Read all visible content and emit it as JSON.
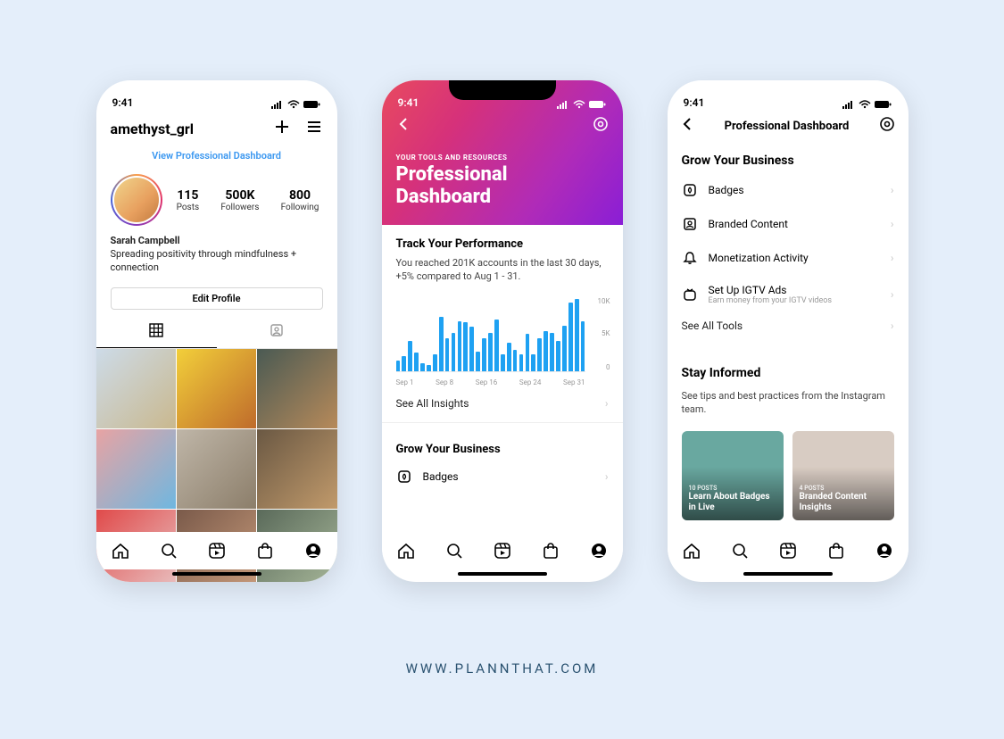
{
  "footer": "WWW.PLANNTHAT.COM",
  "status_time": "9:41",
  "phone1": {
    "username": "amethyst_grl",
    "vpd_link": "View Professional Dashboard",
    "stats": [
      {
        "num": "115",
        "lbl": "Posts"
      },
      {
        "num": "500K",
        "lbl": "Followers"
      },
      {
        "num": "800",
        "lbl": "Following"
      }
    ],
    "display_name": "Sarah Campbell",
    "bio": "Spreading positivity through mindfulness + connection",
    "edit_profile": "Edit Profile"
  },
  "phone2": {
    "eyebrow": "YOUR TOOLS AND RESOURCES",
    "title_line1": "Professional",
    "title_line2": "Dashboard",
    "track_h": "Track Your Performance",
    "track_sub": "You reached 201K accounts in the last 30 days, +5% compared to Aug 1 - 31.",
    "see_all_insights": "See All Insights",
    "grow_h": "Grow Your Business",
    "badges": "Badges"
  },
  "chart_data": {
    "type": "bar",
    "y_ticks": [
      "10K",
      "5K",
      "0"
    ],
    "x_ticks": [
      "Sep 1",
      "Sep 8",
      "Sep 16",
      "Sep 24",
      "Sep 31"
    ],
    "ylim": [
      0,
      10000
    ],
    "values": [
      1500,
      2100,
      4200,
      2600,
      1200,
      900,
      2400,
      7600,
      4600,
      5400,
      7000,
      6800,
      6200,
      2800,
      4600,
      5400,
      7200,
      2400,
      4000,
      3000,
      2400,
      5200,
      2400,
      4600,
      5600,
      5400,
      4200,
      6400,
      9600,
      10000,
      7000
    ]
  },
  "phone3": {
    "title": "Professional Dashboard",
    "grow_h": "Grow Your Business",
    "tools": [
      {
        "icon": "badge",
        "label": "Badges"
      },
      {
        "icon": "branded",
        "label": "Branded Content"
      },
      {
        "icon": "bell",
        "label": "Monetization Activity"
      },
      {
        "icon": "igtv",
        "label": "Set Up IGTV Ads",
        "sub": "Earn money from your IGTV videos"
      }
    ],
    "see_all_tools": "See All Tools",
    "stay_h": "Stay Informed",
    "stay_sub": "See tips and best practices from the Instagram team.",
    "cards": [
      {
        "tag": "10 POSTS",
        "title": "Learn About Badges in Live"
      },
      {
        "tag": "4 POSTS",
        "title": "Branded Content Insights"
      }
    ]
  },
  "grid_colors": [
    "linear-gradient(135deg,#cddbe8,#c9b88e)",
    "linear-gradient(135deg,#f2cf3a,#bf6b2b)",
    "linear-gradient(135deg,#4a5a53,#b78a5a)",
    "linear-gradient(135deg,#e8a3a3,#6fb7e0)",
    "linear-gradient(135deg,#bfb6a8,#8c7e6a)",
    "linear-gradient(135deg,#6a5843,#c19a6b)",
    "linear-gradient(135deg,#e04a4a,#e8c0c0)",
    "linear-gradient(135deg,#7a5a4a,#c79a7a)",
    "linear-gradient(135deg,#5a6a5a,#a8b89a)"
  ],
  "card_colors": [
    "#69a8a0",
    "#d8ccc3"
  ]
}
